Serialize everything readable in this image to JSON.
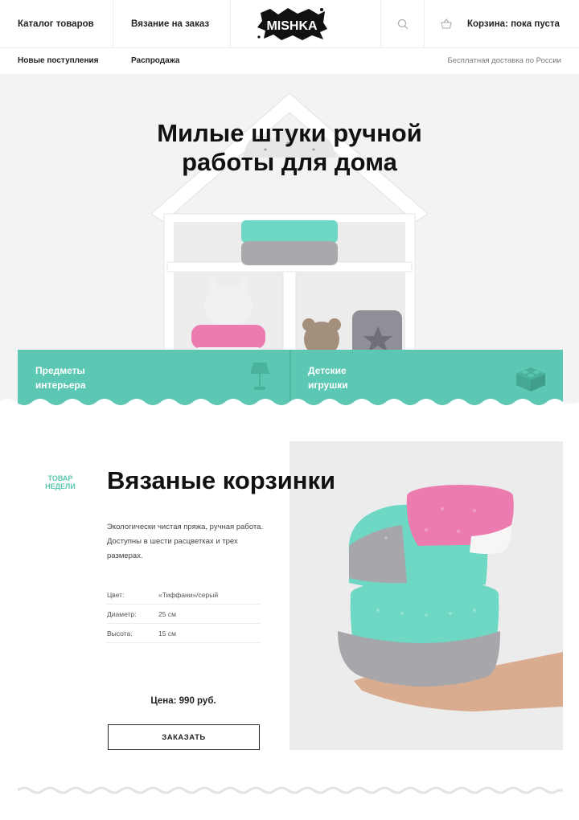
{
  "header": {
    "nav_catalog": "Каталог товаров",
    "nav_knitting": "Вязание на заказ",
    "logo_text": "MISHKA",
    "cart_label": "Корзина: пока пуста",
    "search_icon": "search-icon",
    "cart_icon": "basket-icon"
  },
  "subnav": {
    "new_arrivals": "Новые поступления",
    "sale": "Распродажа",
    "free_delivery": "Бесплатная доставка по России"
  },
  "hero": {
    "title_line1": "Милые штуки ручной",
    "title_line2": "работы для дома"
  },
  "categories": [
    {
      "line1": "Предметы",
      "line2": "интерьера",
      "icon": "lamp-icon"
    },
    {
      "line1": "Детские",
      "line2": "игрушки",
      "icon": "lego-brick-icon"
    }
  ],
  "product": {
    "tag_line1": "ТОВАР",
    "tag_line2": "НЕДЕЛИ",
    "title": "Вязаные корзинки",
    "description": "Экологически чистая пряжа, ручная работа. Доступны в шести расцветках и трех размерах.",
    "specs": [
      {
        "label": "Цвет:",
        "value": "«Тиффани»/серый"
      },
      {
        "label": "Диаметр:",
        "value": "25 см"
      },
      {
        "label": "Высота:",
        "value": "15 см"
      }
    ],
    "price": "Цена: 990 руб.",
    "order_label": "ЗАКАЗАТЬ"
  },
  "colors": {
    "accent": "#5cc7b2",
    "text": "#222222",
    "pink": "#ec7bb0",
    "grey": "#a7a7ab"
  }
}
